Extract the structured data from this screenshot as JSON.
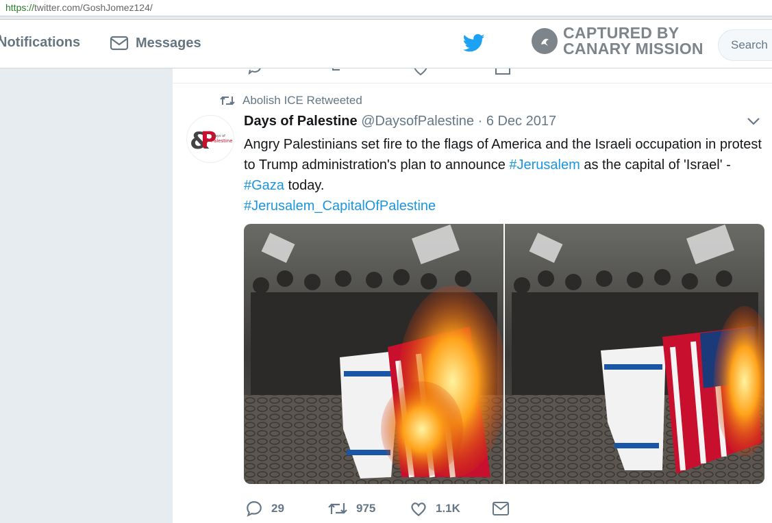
{
  "browser": {
    "url_protocol": "https://",
    "url_rest": "twitter.com/GoshJomez124/"
  },
  "nav": {
    "notifications_label": "Notifications",
    "messages_label": "Messages"
  },
  "watermark": {
    "line1": "CAPTURED BY",
    "line2": "CANARY MISSION"
  },
  "search": {
    "placeholder": "Search"
  },
  "tweet": {
    "retweeted_by": "Abolish ICE Retweeted",
    "author_name": "Days of Palestine",
    "author_handle": "@DaysofPalestine",
    "separator": "·",
    "date": "6 Dec 2017",
    "text_part1": "Angry Palestinians set fire to the flags of America and the Israeli occupation in protest to Trump administration's plan to announce ",
    "hashtag1": "#Jerusalem",
    "text_part2": " as the capital of 'Israel' - ",
    "hashtag2": "#Gaza",
    "text_part3": " today.",
    "hashtag3": "#Jerusalem_CapitalOfPalestine",
    "replies": "29",
    "retweets": "975",
    "likes": "1.1K"
  },
  "colors": {
    "link": "#1b95e0",
    "twitter_blue": "#1da1f2",
    "muted": "#657786",
    "flag_red": "#c8102e",
    "flag_blue": "#1b55a5"
  },
  "icons": [
    "reply-icon",
    "retweet-icon",
    "like-icon",
    "dm-icon",
    "twitter-bird-icon",
    "envelope-icon",
    "chevron-down-icon"
  ]
}
